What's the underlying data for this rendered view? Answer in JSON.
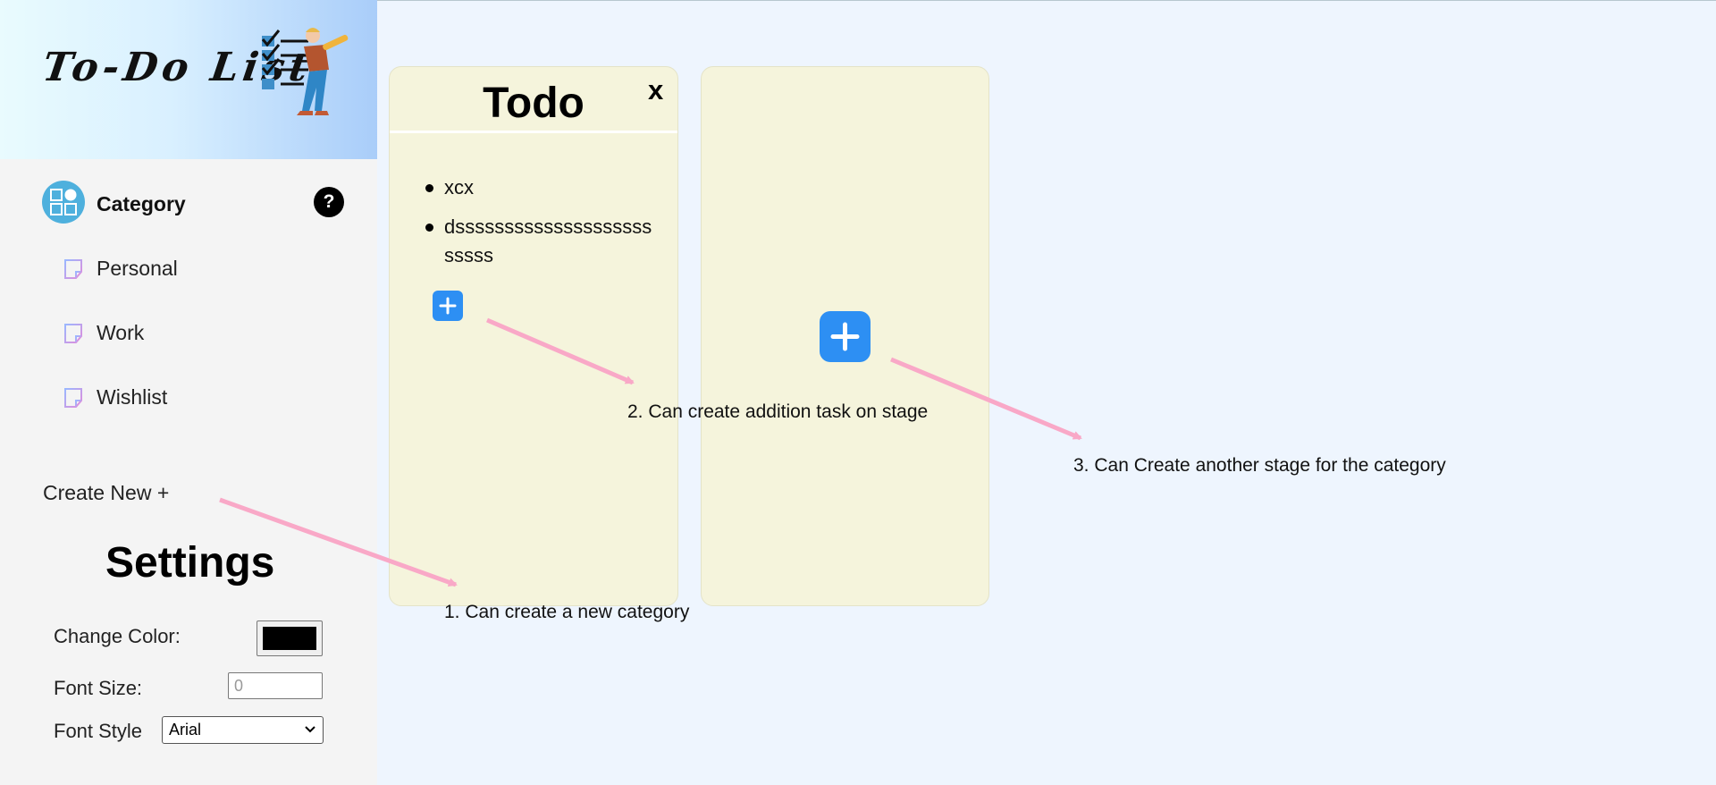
{
  "sidebar": {
    "logo_text": "To-Do List",
    "category_header": "Category",
    "help_label": "?",
    "categories": [
      {
        "label": "Personal"
      },
      {
        "label": "Work"
      },
      {
        "label": "Wishlist"
      }
    ],
    "create_new_label": "Create New +"
  },
  "settings": {
    "title": "Settings",
    "change_color_label": "Change Color:",
    "color_value": "#000000",
    "font_size_label": "Font Size:",
    "font_size_placeholder": "0",
    "font_style_label": "Font Style",
    "font_style_value": "Arial"
  },
  "stages": [
    {
      "title": "Todo",
      "close_label": "x",
      "tasks": [
        "xcx",
        "dsssssssssssssssssssssssss"
      ]
    },
    {
      "title": "",
      "tasks": []
    }
  ],
  "annotations": {
    "note_1": "1. Can create a new category",
    "note_2": "2. Can create addition task on stage",
    "note_3": "3. Can Create another stage for the category"
  },
  "colors": {
    "page_bg": "#eef5fe",
    "sidebar_bg": "#f4f4f4",
    "stage_bg": "#f5f4dc",
    "accent_blue": "#2d8ff3",
    "arrow_pink": "#f9a8c7",
    "category_icon": "#4eb0dd"
  },
  "icons": {
    "category": "category-grid-icon",
    "category_item": "note-icon",
    "help": "question-icon",
    "add": "plus-icon",
    "close": "close-icon",
    "dropdown": "chevron-down-icon"
  }
}
